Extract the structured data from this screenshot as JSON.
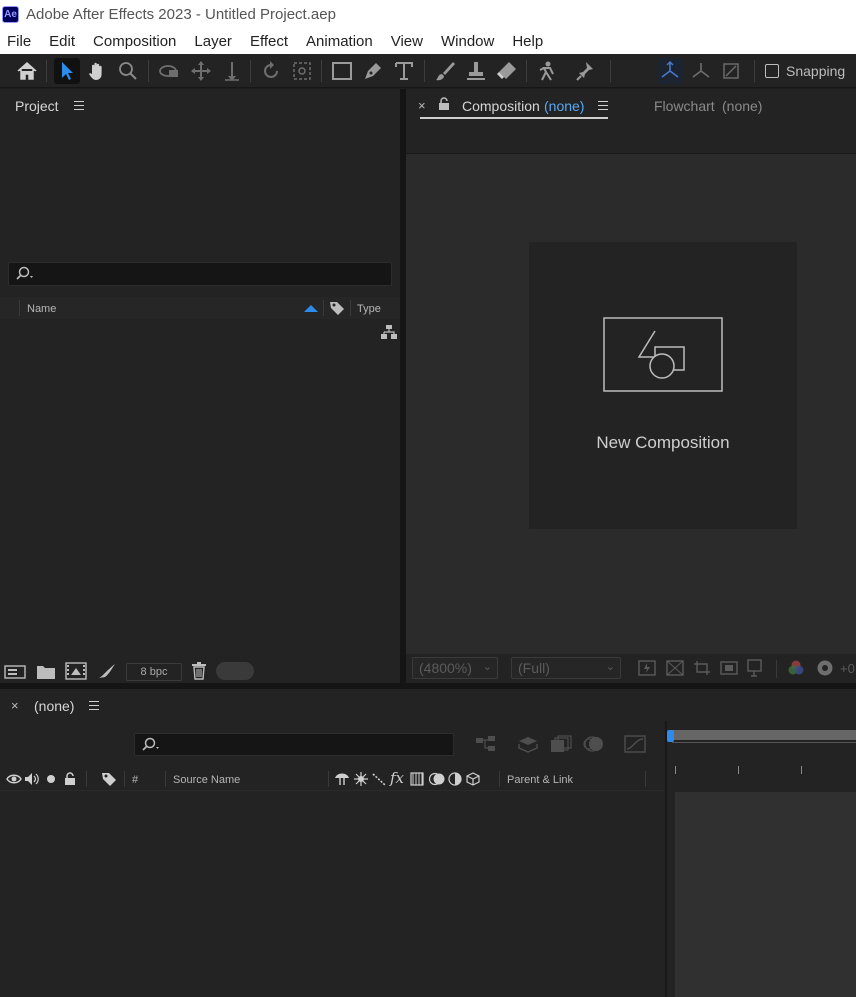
{
  "window": {
    "title": "Adobe After Effects 2023 - Untitled Project.aep",
    "logo_text": "Ae"
  },
  "menu": [
    "File",
    "Edit",
    "Composition",
    "Layer",
    "Effect",
    "Animation",
    "View",
    "Window",
    "Help"
  ],
  "toolbar": {
    "tools": [
      "home-icon",
      "selection-icon",
      "hand-icon",
      "zoom-icon",
      "orbit-camera-icon",
      "pan-camera-icon",
      "dolly-camera-icon",
      "rotate-icon",
      "anchor-point-icon",
      "rectangle-icon",
      "pen-icon",
      "type-icon",
      "brush-icon",
      "clone-stamp-icon",
      "eraser-icon",
      "roto-brush-icon",
      "puppet-pin-icon",
      "world-axis-icon",
      "local-axis-icon",
      "view-axis-icon"
    ],
    "snapping_label": "Snapping"
  },
  "project": {
    "title": "Project",
    "columns": {
      "name": "Name",
      "type": "Type"
    },
    "bpc_label": "8 bpc"
  },
  "composition": {
    "tab_label": "Composition",
    "tab_value": "(none)",
    "flowchart_label": "Flowchart",
    "flowchart_value": "(none)",
    "new_comp_label": "New Composition",
    "zoom_value": "(4800%)",
    "resolution_value": "(Full)",
    "offset_label": "+0"
  },
  "timeline": {
    "tab_label": "(none)",
    "columns": {
      "number": "#",
      "source_name": "Source Name",
      "parent": "Parent & Link"
    }
  },
  "colors": {
    "accent": "#2d8ceb",
    "link": "#5aa9f0"
  }
}
